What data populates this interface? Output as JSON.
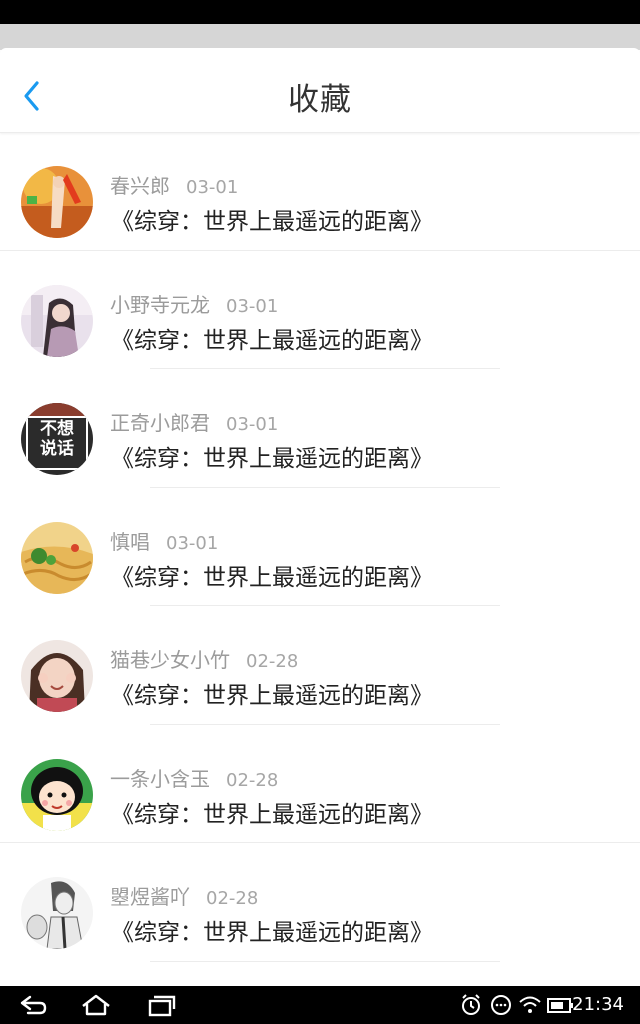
{
  "header": {
    "title": "收藏"
  },
  "items": [
    {
      "name": "春兴郎",
      "date": "03-01",
      "work": "《综穿：世界上最遥远的距离》",
      "avatar": "game-character-avatar"
    },
    {
      "name": "小野寺元龙",
      "date": "03-01",
      "work": "《综穿：世界上最遥远的距离》",
      "avatar": "girl-photo-avatar"
    },
    {
      "name": "正奇小郎君",
      "date": "03-01",
      "work": "《综穿：世界上最遥远的距离》",
      "avatar": "text-avatar",
      "avatar_text": "不想说话"
    },
    {
      "name": "慎唱",
      "date": "03-01",
      "work": "《综穿：世界上最遥远的距离》",
      "avatar": "noodles-avatar"
    },
    {
      "name": "猫巷少女小竹",
      "date": "02-28",
      "work": "《综穿：世界上最遥远的距离》",
      "avatar": "child-photo-avatar"
    },
    {
      "name": "一条小含玉",
      "date": "02-28",
      "work": "《综穿：世界上最遥远的距离》",
      "avatar": "cartoon-girl-avatar"
    },
    {
      "name": "曌煜酱吖",
      "date": "02-28",
      "work": "《综穿：世界上最遥远的距离》",
      "avatar": "anime-sketch-avatar"
    }
  ],
  "system": {
    "time": "21:34"
  },
  "colors": {
    "accent": "#1a9af0"
  }
}
